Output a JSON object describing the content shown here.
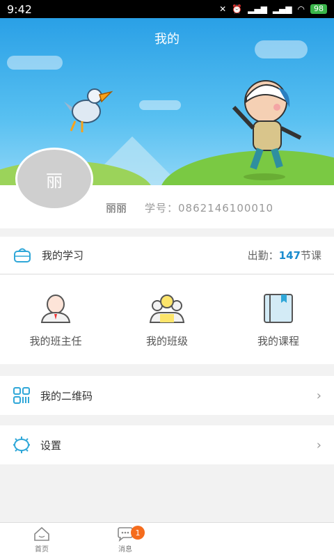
{
  "status_bar": {
    "time": "9:42",
    "battery": "98"
  },
  "header": {
    "title": "我的"
  },
  "profile": {
    "avatar_char": "丽",
    "name": "丽丽",
    "student_id_label": "学号：0862146100010"
  },
  "study": {
    "label": "我的学习",
    "attendance_prefix": "出勤：",
    "attendance_count": "147",
    "attendance_suffix": "节课"
  },
  "shortcuts": [
    {
      "label": "我的班主任",
      "icon": "teacher-icon"
    },
    {
      "label": "我的班级",
      "icon": "class-icon"
    },
    {
      "label": "我的课程",
      "icon": "course-book-icon"
    }
  ],
  "menu": {
    "qr_label": "我的二维码",
    "settings_label": "设置"
  },
  "tabbar": {
    "items": [
      {
        "label": "首页",
        "icon": "home-icon"
      },
      {
        "label": "消息",
        "icon": "message-icon",
        "badge": "1"
      },
      {
        "label": "",
        "icon": ""
      },
      {
        "label": "",
        "icon": ""
      }
    ]
  },
  "colors": {
    "accent": "#1b8ccf",
    "badge": "#f56c1d",
    "sky": "#2aa0e6"
  }
}
